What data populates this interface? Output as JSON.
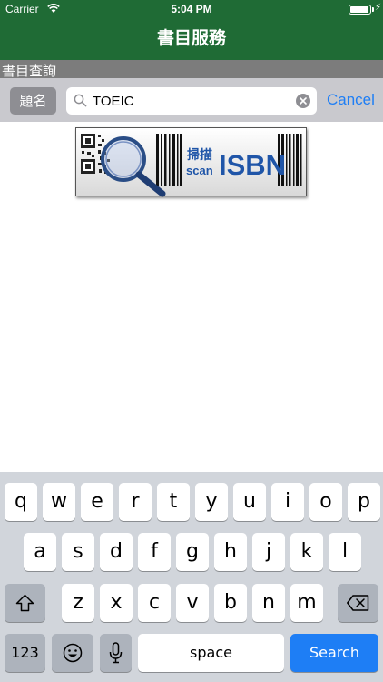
{
  "status_bar": {
    "carrier": "Carrier",
    "time": "5:04 PM",
    "battery_level": 0.95
  },
  "nav": {
    "title": "書目服務"
  },
  "section": {
    "header": "書目查詢"
  },
  "search": {
    "scope_label": "題名",
    "value": "TOEIC",
    "cancel_label": "Cancel"
  },
  "banner": {
    "line1": "掃描",
    "line2": "scan",
    "isbn": "ISBN"
  },
  "keyboard": {
    "row1": [
      "q",
      "w",
      "e",
      "r",
      "t",
      "y",
      "u",
      "i",
      "o",
      "p"
    ],
    "row2": [
      "a",
      "s",
      "d",
      "f",
      "g",
      "h",
      "j",
      "k",
      "l"
    ],
    "row3": [
      "z",
      "x",
      "c",
      "v",
      "b",
      "n",
      "m"
    ],
    "numbers_label": "123",
    "space_label": "space",
    "search_label": "Search"
  },
  "colors": {
    "nav_green": "#1f6b35",
    "accent_blue": "#1e7ef5",
    "section_gray": "#7c7c7c"
  },
  "icons": [
    "wifi-icon",
    "battery-icon",
    "magnifier-icon",
    "clear-icon",
    "qr-code-icon",
    "barcode-icon",
    "shift-icon",
    "backspace-icon",
    "emoji-icon",
    "microphone-icon"
  ]
}
